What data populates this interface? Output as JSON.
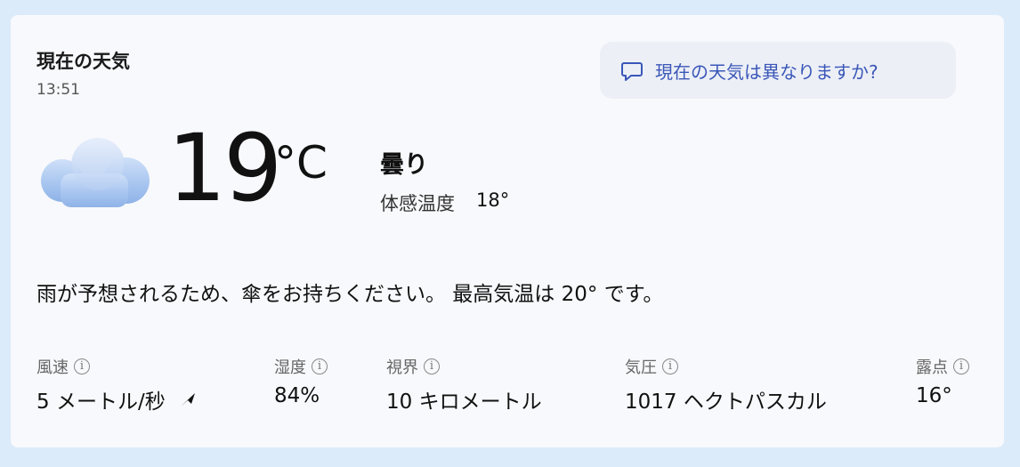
{
  "header": {
    "title": "現在の天気",
    "time": "13:51"
  },
  "feedback": {
    "label": "現在の天気は異なりますか?"
  },
  "current": {
    "icon": "cloud-icon",
    "temperature": "19",
    "unit": "°C",
    "condition": "曇り",
    "feels_like_label": "体感温度",
    "feels_like_value": "18°"
  },
  "summary": "雨が予想されるため、傘をお持ちください。 最高気温は 20° です。",
  "metrics": [
    {
      "label": "風速",
      "value": "5 メートル/秒",
      "icon": "wind-direction-icon"
    },
    {
      "label": "湿度",
      "value": "84%"
    },
    {
      "label": "視界",
      "value": "10 キロメートル"
    },
    {
      "label": "気圧",
      "value": "1017 ヘクトパスカル"
    },
    {
      "label": "露点",
      "value": "16°"
    }
  ],
  "colors": {
    "background": "#dcebfa",
    "card": "#f8f9fc",
    "accent": "#3a57b8"
  }
}
